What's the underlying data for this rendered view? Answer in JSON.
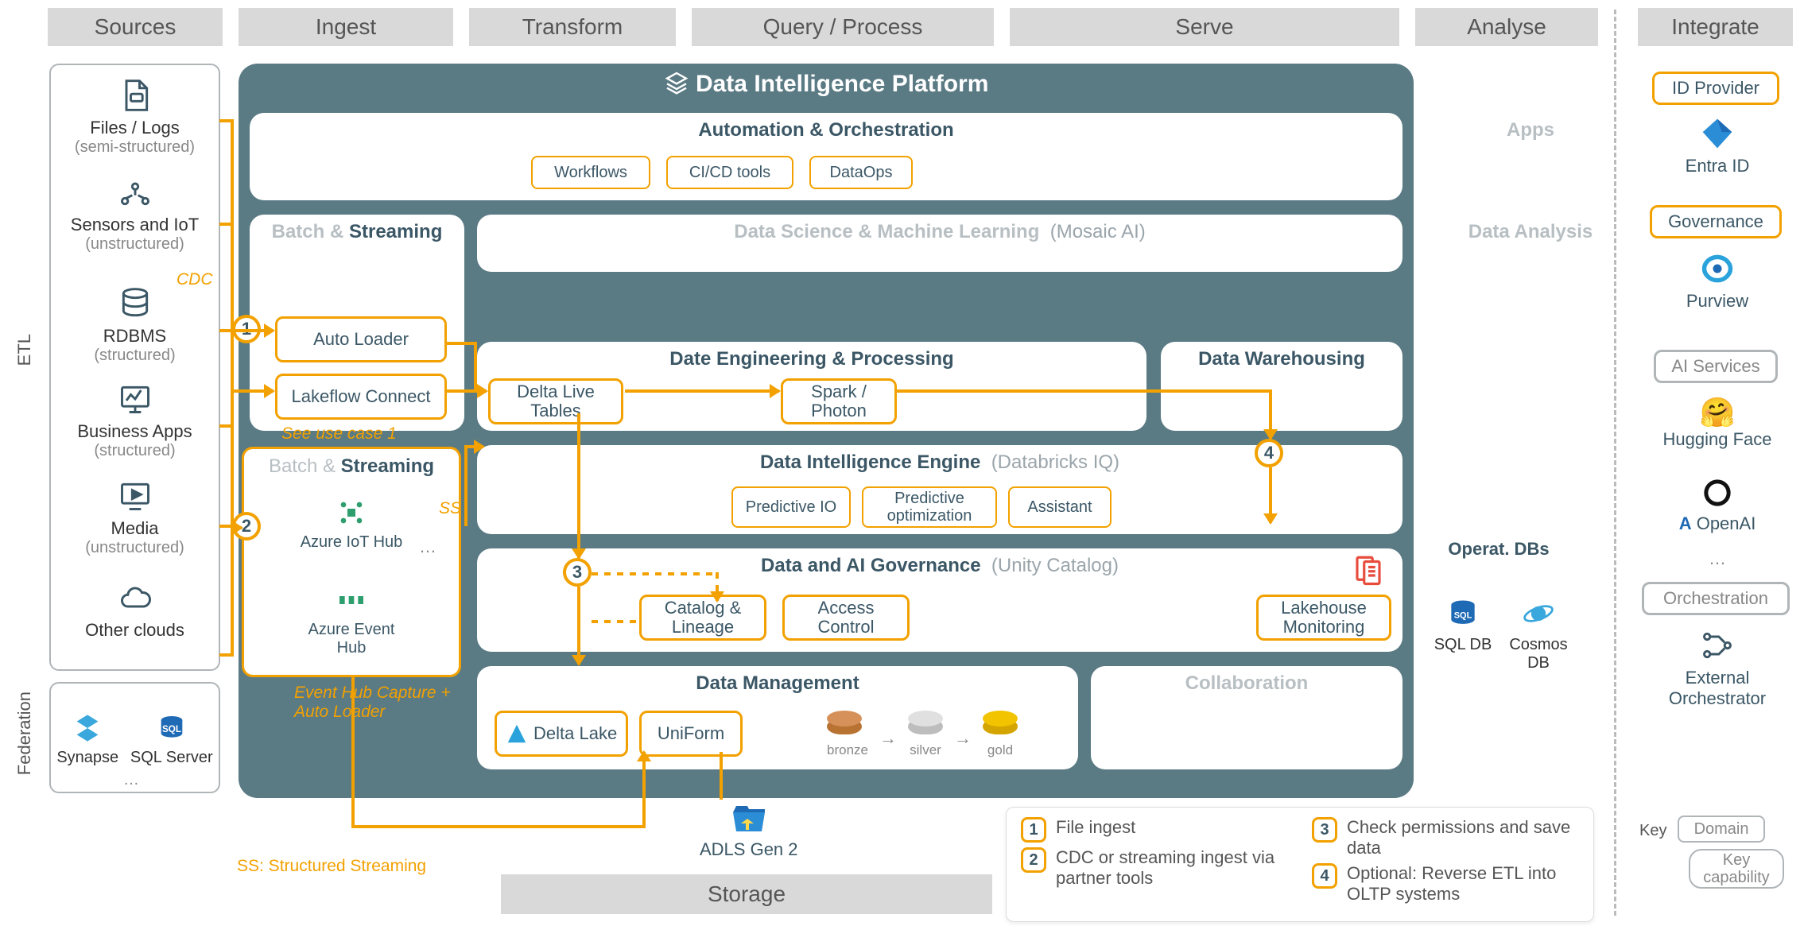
{
  "columns": {
    "sources": "Sources",
    "ingest": "Ingest",
    "transform": "Transform",
    "query": "Query / Process",
    "serve": "Serve",
    "analyse": "Analyse",
    "integrate": "Integrate",
    "storage": "Storage"
  },
  "side_labels": {
    "etl": "ETL",
    "federation": "Federation"
  },
  "sources": {
    "files": {
      "label": "Files / Logs",
      "sub": "(semi-structured)"
    },
    "sensors": {
      "label": "Sensors and IoT",
      "sub": "(unstructured)"
    },
    "rdbms": {
      "label": "RDBMS",
      "sub": "(structured)",
      "badge": "CDC"
    },
    "bizapps": {
      "label": "Business Apps",
      "sub": "(structured)"
    },
    "media": {
      "label": "Media",
      "sub": "(unstructured)"
    },
    "clouds": {
      "label": "Other clouds"
    }
  },
  "federation": {
    "synapse": "Synapse",
    "sqlserver": "SQL Server",
    "more": "…"
  },
  "platform": {
    "title": "Data Intelligence Platform",
    "automation": {
      "title": "Automation & Orchestration",
      "workflows": "Workflows",
      "cicd": "CI/CD tools",
      "dataops": "DataOps"
    },
    "batch_streaming_top": {
      "batch": "Batch &",
      "streaming": "Streaming"
    },
    "ds_ml": {
      "title": "Data Science & Machine Learning",
      "suffix": "(Mosaic AI)"
    },
    "apps": "Apps",
    "data_analysis": "Data Analysis",
    "auto_loader": "Auto Loader",
    "lakeflow": "Lakeflow Connect",
    "see_usecase": "See use case 1",
    "engineering": {
      "title": "Date Engineering & Processing",
      "dlt": "Delta Live Tables",
      "spark": "Spark / Photon"
    },
    "warehousing": {
      "title": "Data Warehousing"
    },
    "intelligence": {
      "title": "Data Intelligence Engine",
      "suffix": "(Databricks IQ)",
      "predio": "Predictive IO",
      "predopt": "Predictive optimization",
      "assistant": "Assistant"
    },
    "governance": {
      "title": "Data and AI Governance",
      "suffix": "(Unity Catalog)",
      "catalog": "Catalog & Lineage",
      "access": "Access Control",
      "monitoring": "Lakehouse Monitoring"
    },
    "data_mgmt": {
      "title": "Data Management",
      "delta": "Delta Lake",
      "uniform": "UniForm",
      "medallion": {
        "bronze": "bronze",
        "silver": "silver",
        "gold": "gold"
      }
    },
    "collaboration": "Collaboration",
    "oper_dbs": {
      "title": "Operat. DBs",
      "sql": "SQL DB",
      "cosmos": "Cosmos DB"
    },
    "batch_streaming_ext": {
      "batch": "Batch &",
      "streaming": "Streaming",
      "iot": "Azure IoT Hub",
      "eventhub": "Azure Event Hub",
      "more": "…",
      "caption": "Event Hub Capture + Auto Loader",
      "ss_badge": "SS"
    },
    "adls": "ADLS Gen 2",
    "ss_note": "SS: Structured Streaming"
  },
  "steps": {
    "s1": "1",
    "s2": "2",
    "s3": "3",
    "s4": "4"
  },
  "legend": {
    "l1": "File ingest",
    "l2": "CDC or streaming ingest via partner tools",
    "l3": "Check permissions and save data",
    "l4": "Optional: Reverse ETL into OLTP systems"
  },
  "integrate": {
    "id_provider": "ID Provider",
    "entra": "Entra ID",
    "governance": "Governance",
    "purview": "Purview",
    "ai_services": "AI Services",
    "hf": "Hugging Face",
    "openai": "OpenAI",
    "more": "…",
    "orchestration": "Orchestration",
    "ext_orch": "External Orchestrator"
  },
  "key": {
    "label": "Key",
    "domain": "Domain",
    "capability": "Key capability"
  }
}
